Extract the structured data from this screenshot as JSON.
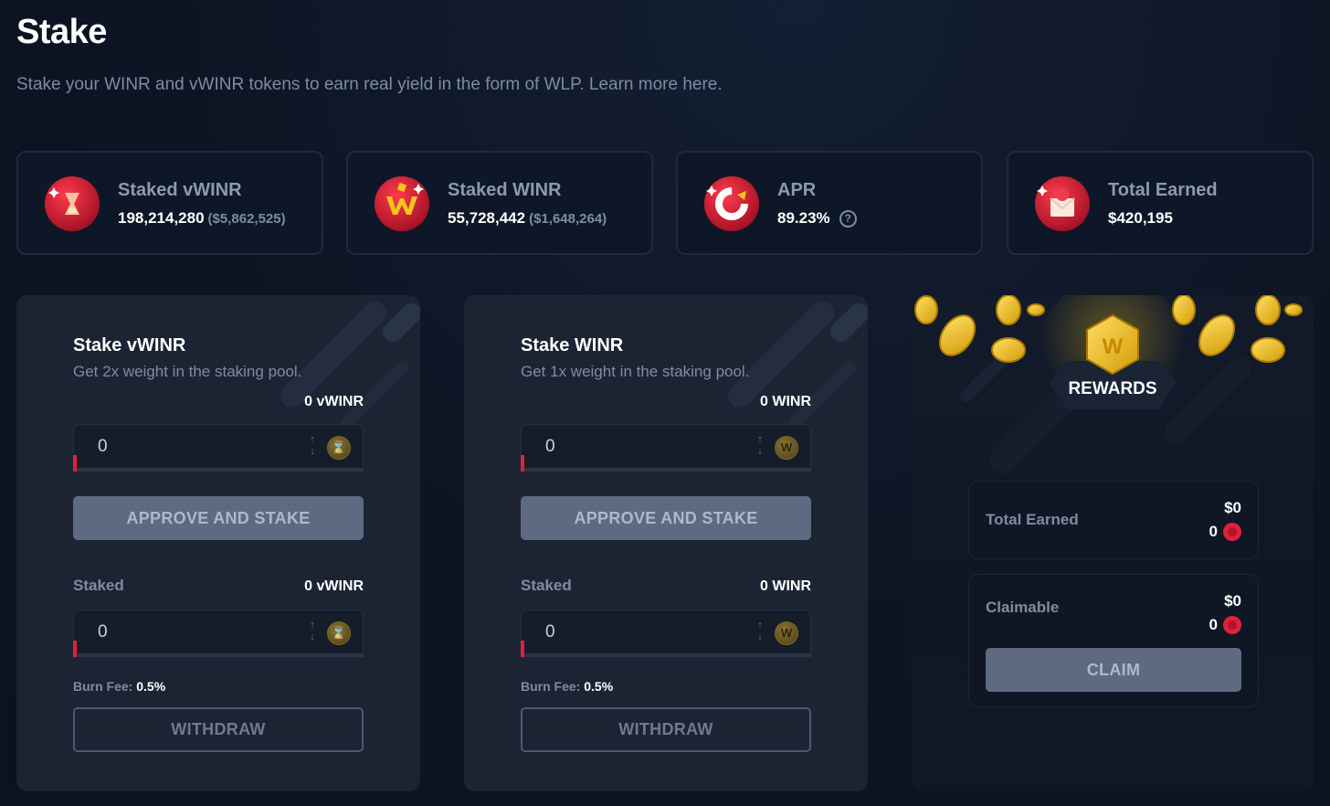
{
  "page": {
    "title": "Stake",
    "subtitle": "Stake your WINR and vWINR tokens to earn real yield in the form of WLP. Learn more here."
  },
  "stats": [
    {
      "label": "Staked vWINR",
      "value": "198,214,280",
      "sub": "($5,862,525)",
      "icon": "vwinr-hourglass-icon"
    },
    {
      "label": "Staked WINR",
      "value": "55,728,442",
      "sub": "($1,648,264)",
      "icon": "winr-logo-icon"
    },
    {
      "label": "APR",
      "value": "89.23%",
      "icon": "apr-chart-icon"
    },
    {
      "label": "Total Earned",
      "value": "$420,195",
      "icon": "envelope-icon"
    }
  ],
  "stake_vwinr": {
    "title": "Stake vWINR",
    "description": "Get 2x weight in the staking pool.",
    "balance": "0 vWINR",
    "input_value": "0",
    "approve_label": "APPROVE AND STAKE",
    "staked_label": "Staked",
    "staked_balance": "0 vWINR",
    "withdraw_input_value": "0",
    "burn_fee_label": "Burn Fee:",
    "burn_fee_value": "0.5%",
    "withdraw_label": "WITHDRAW"
  },
  "stake_winr": {
    "title": "Stake WINR",
    "description": "Get 1x weight in the staking pool.",
    "balance": "0 WINR",
    "input_value": "0",
    "approve_label": "APPROVE AND STAKE",
    "staked_label": "Staked",
    "staked_balance": "0 WINR",
    "withdraw_input_value": "0",
    "burn_fee_label": "Burn Fee:",
    "burn_fee_value": "0.5%",
    "withdraw_label": "WITHDRAW"
  },
  "rewards": {
    "title": "REWARDS",
    "total_earned_label": "Total Earned",
    "total_earned_usd": "$0",
    "total_earned_amount": "0",
    "claimable_label": "Claimable",
    "claimable_usd": "$0",
    "claimable_amount": "0",
    "claim_label": "CLAIM"
  },
  "colors": {
    "background": "#0d1524",
    "card": "#1c2434",
    "accent_red": "#e0213a",
    "button": "#5d6a82",
    "gold": "#f5c518"
  }
}
